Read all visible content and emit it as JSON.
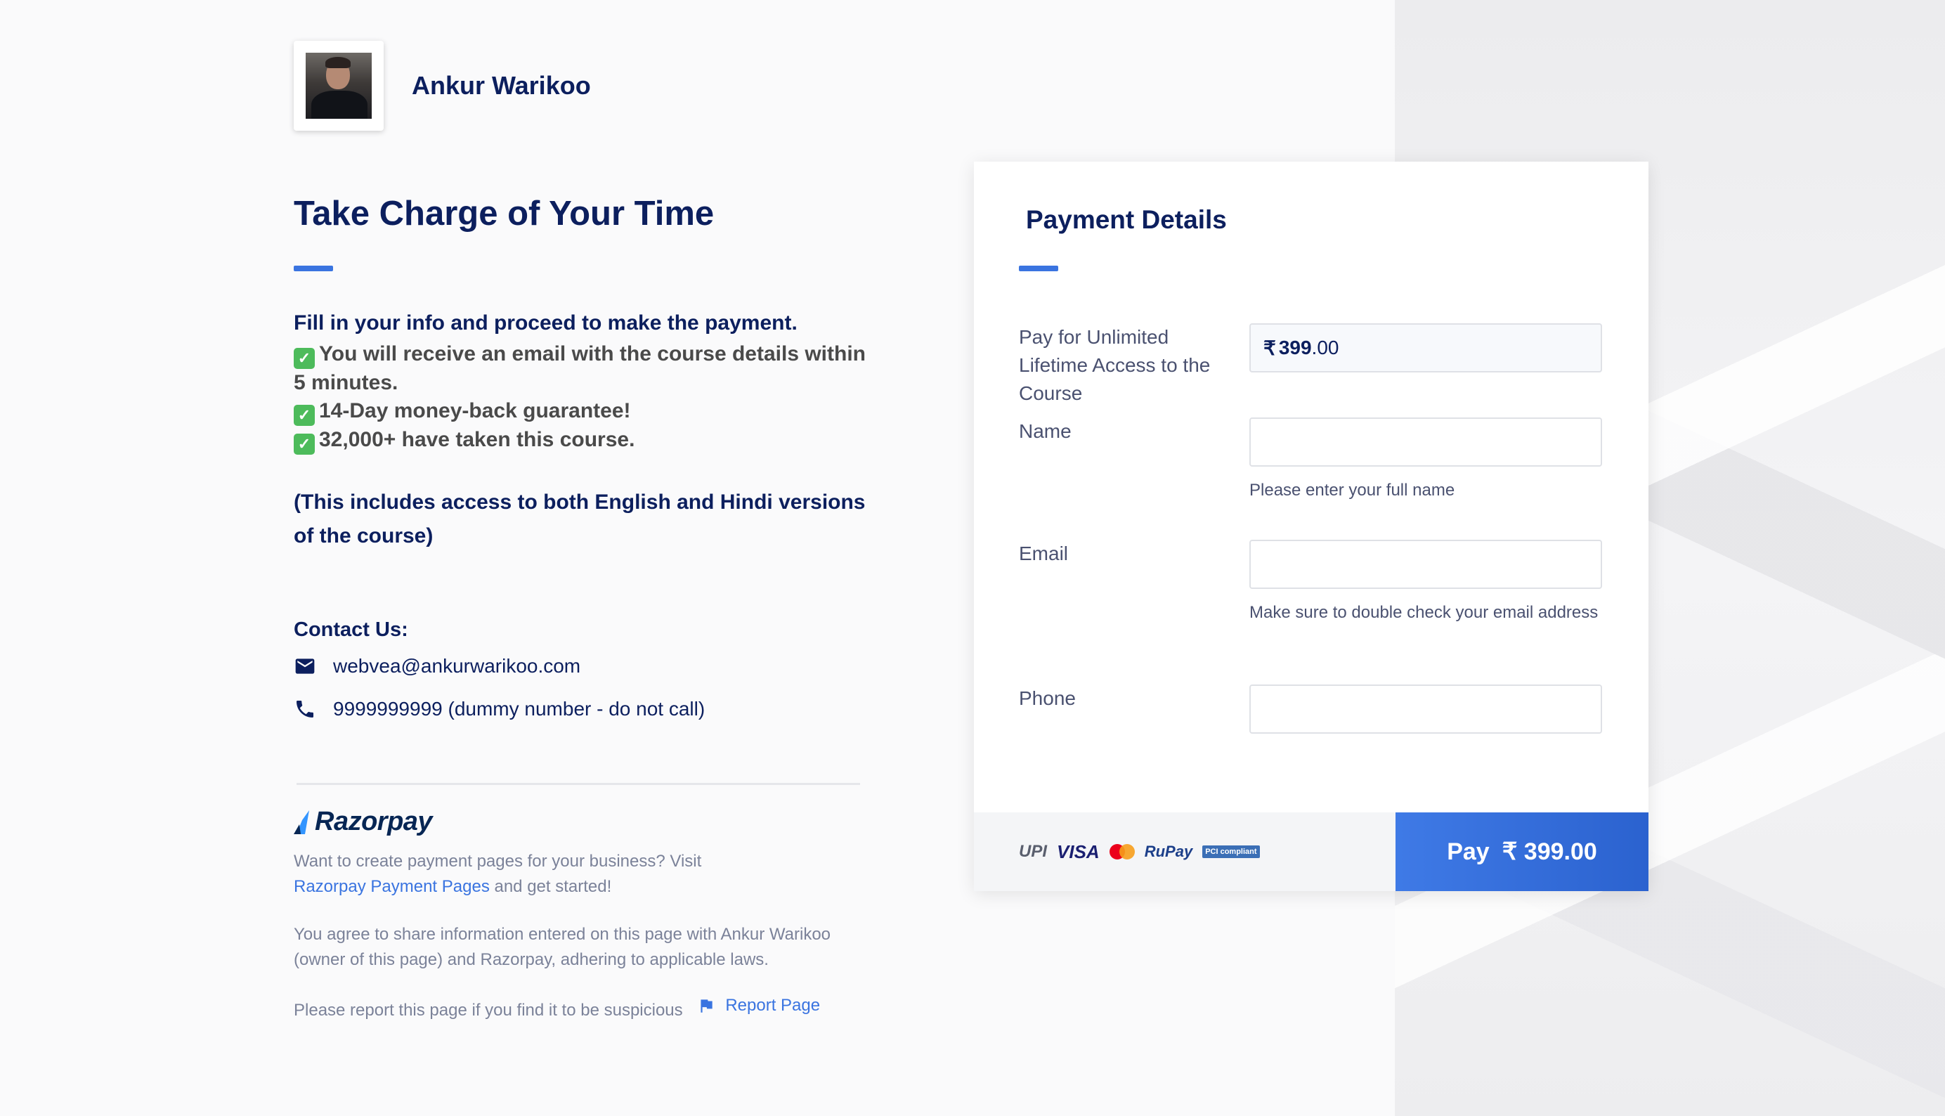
{
  "merchant": {
    "name": "Ankur Warikoo"
  },
  "page": {
    "title": "Take Charge of Your Time"
  },
  "description": {
    "lead": "Fill in your info and proceed to make the payment.",
    "bullets": [
      "You will receive an email with the course details within 5 minutes.",
      "14-Day money-back guarantee!",
      "32,000+ have taken this course."
    ],
    "note": "(This includes access to both English and Hindi versions of the course)"
  },
  "contact": {
    "title": "Contact Us:",
    "email": "webvea@ankurwarikoo.com",
    "phone": "9999999999 (dummy number - do not call)"
  },
  "footer": {
    "logo_text": "Razorpay",
    "promo_prefix": "Want to create payment pages for your business? Visit",
    "promo_link": "Razorpay Payment Pages",
    "promo_suffix": "and get started!",
    "consent": "You agree to share information entered on this page with Ankur Warikoo (owner of this page) and Razorpay, adhering to applicable laws.",
    "report_text": "Please report this page if you find it to be suspicious",
    "report_link": "Report Page"
  },
  "payment": {
    "title": "Payment Details",
    "amount_label": "Pay for Unlimited Lifetime Access to the Course",
    "currency_symbol": "₹",
    "amount_int": "399",
    "amount_dec": ".00",
    "fields": {
      "name": {
        "label": "Name",
        "value": "",
        "help": "Please enter your full name"
      },
      "email": {
        "label": "Email",
        "value": "",
        "help": "Make sure to double check your email address"
      },
      "phone": {
        "label": "Phone",
        "value": ""
      }
    },
    "methods": {
      "upi": "UPI",
      "visa": "VISA",
      "rupay": "RuPay",
      "pci": "PCI compliant"
    },
    "pay_button": {
      "label": "Pay",
      "amount": "₹ 399.00"
    }
  },
  "colors": {
    "accent": "#3a74e0",
    "navy": "#0c1f5e",
    "check": "#4dbb5b"
  },
  "icons": [
    "email-icon",
    "phone-icon",
    "flag-icon",
    "razorpay-logo-icon",
    "checkmark-icon"
  ]
}
